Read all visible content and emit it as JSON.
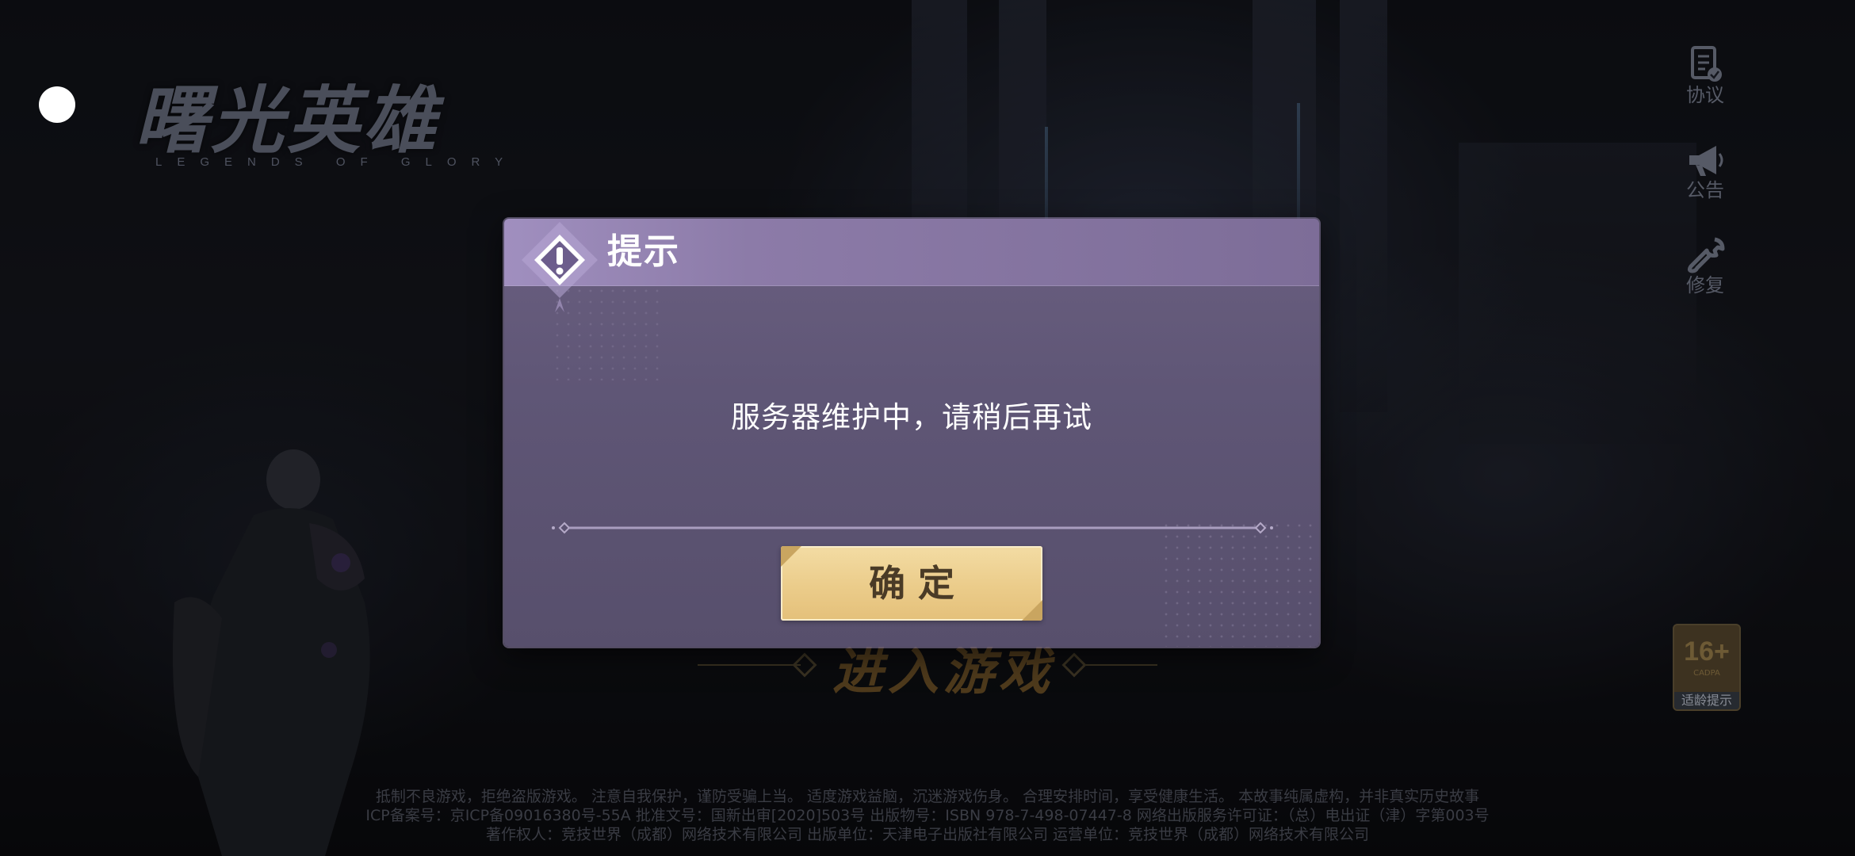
{
  "status_dot": "",
  "logo": {
    "title_cn": "曙光英雄",
    "title_en": "LEGENDS OF GLORY"
  },
  "side_menu": {
    "agreement_label": "协议",
    "notice_label": "公告",
    "repair_label": "修复"
  },
  "age_badge": {
    "rating": "16+",
    "sub": "CADPA",
    "label": "适龄提示"
  },
  "main": {
    "enter_game_label": "进入游戏"
  },
  "dialog": {
    "title": "提示",
    "message": "服务器维护中，请稍后再试",
    "confirm_label": "确定"
  },
  "footer": {
    "line1": "抵制不良游戏，拒绝盗版游戏。 注意自我保护，谨防受骗上当。 适度游戏益脑，沉迷游戏伤身。 合理安排时间，享受健康生活。 本故事纯属虚构，并非真实历史故事",
    "line2": "ICP备案号：京ICP备09016380号-55A  批准文号：国新出审[2020]503号  出版物号：ISBN 978-7-498-07447-8  网络出版服务许可证：（总）电出证（津）字第003号",
    "line3": "著作权人：竞技世界（成都）网络技术有限公司  出版单位：天津电子出版社有限公司  运营单位：竞技世界（成都）网络技术有限公司"
  },
  "colors": {
    "dialog_bg": "#5f5676",
    "dialog_header": "#8c7ba8",
    "confirm_bg": "#ebcc8a",
    "confirm_text": "#4a3b26"
  },
  "icons": {
    "agreement": "document-check-icon",
    "notice": "megaphone-icon",
    "repair": "wrench-icon",
    "dialog": "exclamation-diamond-icon"
  }
}
